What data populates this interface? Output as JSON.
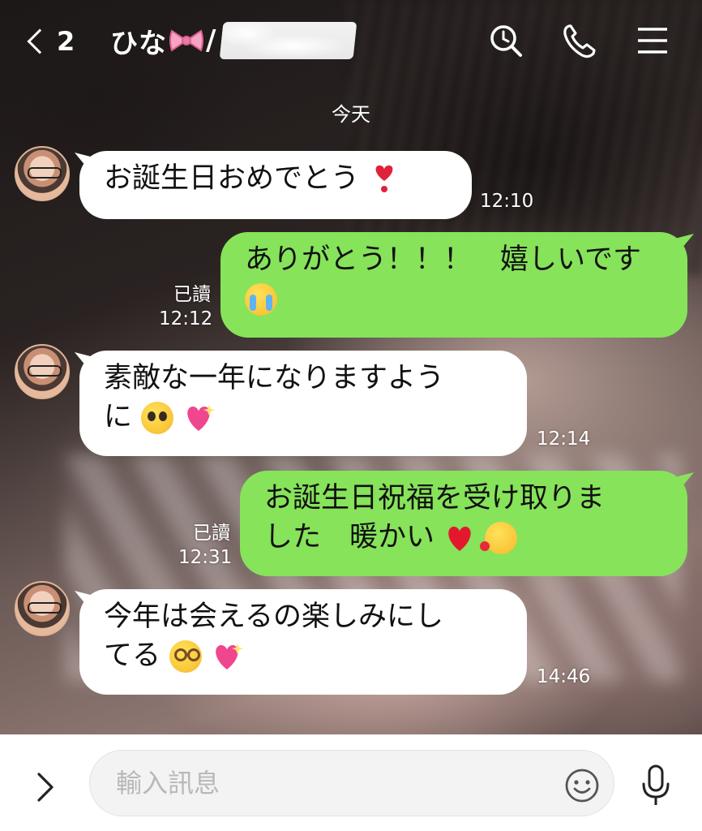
{
  "header": {
    "back_count": "2",
    "contact_name": "ひな",
    "contact_suffix": "/"
  },
  "date_separator": "今天",
  "messages": [
    {
      "side": "in",
      "text": "お誕生日おめでとう",
      "emoji": "heavy-exclamation-heart",
      "time": "12:10"
    },
    {
      "side": "out",
      "line1": "ありがとう！！！　嬉しいです",
      "emoji": "loudly-crying-face",
      "read": "已讀",
      "time": "12:12"
    },
    {
      "side": "in",
      "line1": "素敵な一年になりますよう",
      "line2": "に",
      "emoji": [
        "pleading-face",
        "sparkling-heart"
      ],
      "time": "12:14"
    },
    {
      "side": "out",
      "line1": "お誕生日祝福を受け取りま",
      "line2": "した　暖かい",
      "emoji": [
        "red-heart",
        "smiling-face-with-hearts"
      ],
      "read": "已讀",
      "time": "12:31"
    },
    {
      "side": "in",
      "line1": "今年は会えるの楽しみにし",
      "line2": "てる",
      "emoji": [
        "dizzy-face",
        "sparkling-heart"
      ],
      "time": "14:46"
    }
  ],
  "composer": {
    "placeholder": "輸入訊息",
    "value": ""
  },
  "icons": [
    "back-chevron-icon",
    "ribbon-icon",
    "search-icon",
    "phone-icon",
    "menu-icon",
    "expand-icon",
    "smiley-icon",
    "microphone-icon"
  ],
  "colors": {
    "incoming_bubble": "#ffffff",
    "outgoing_bubble": "#86e35a",
    "header_text": "#ffffff",
    "composer_bg": "#f3f3f3"
  }
}
